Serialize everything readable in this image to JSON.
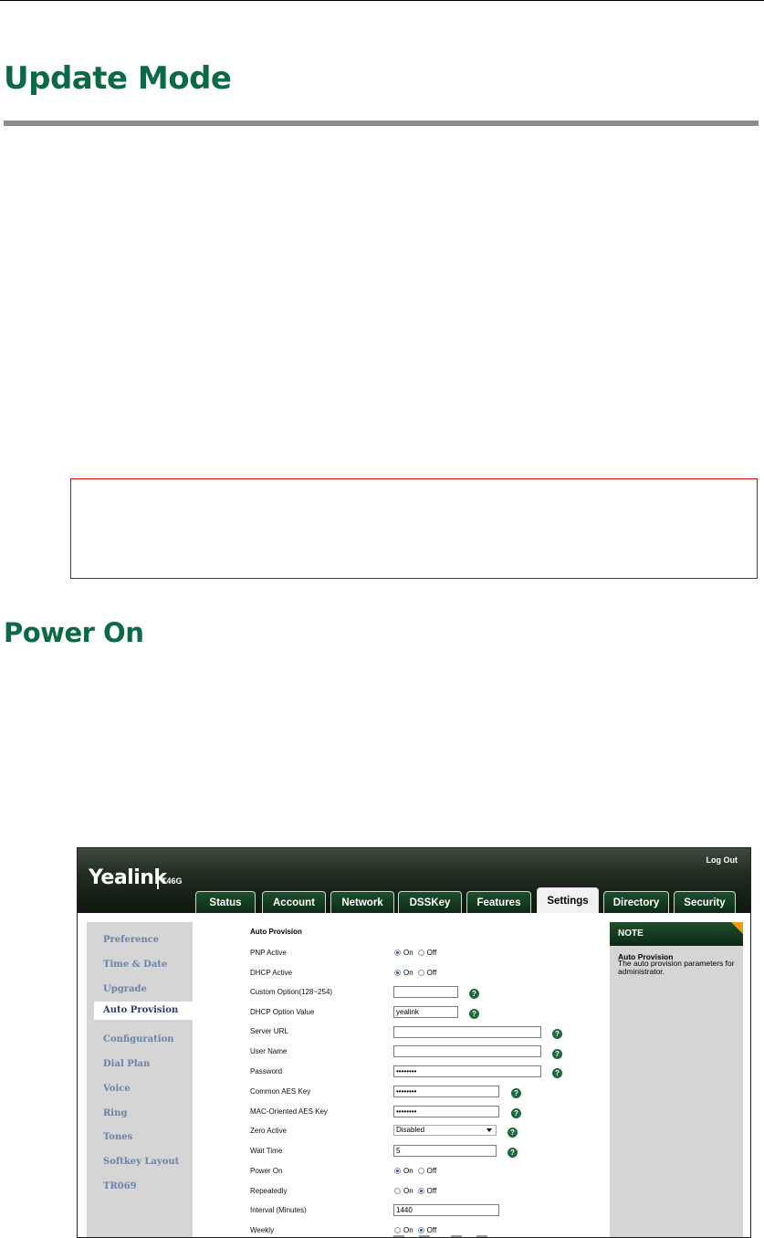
{
  "doc": {
    "title": "Update Mode",
    "section": "Power On"
  },
  "ui": {
    "logo": "Yealink",
    "model": "T46G",
    "logout": "Log Out",
    "tabs": [
      "Status",
      "Account",
      "Network",
      "DSSKey",
      "Features",
      "Settings",
      "Directory",
      "Security"
    ],
    "active_tab": "Settings",
    "nav": [
      "Preference",
      "Time & Date",
      "Upgrade",
      "Auto Provision",
      "Configuration",
      "Dial Plan",
      "Voice",
      "Ring",
      "Tones",
      "Softkey Layout",
      "TR069"
    ],
    "active_nav": "Auto Provision",
    "form": {
      "title": "Auto Provision",
      "pnp_label": "PNP Active",
      "dhcp_label": "DHCP Active",
      "custom_option_label": "Custom Option(128~254)",
      "custom_option_value": "",
      "dhcp_option_label": "DHCP Option Value",
      "dhcp_option_value": "yealink",
      "server_url_label": "Server URL",
      "server_url_value": "",
      "user_name_label": "User Name",
      "user_name_value": "",
      "password_label": "Password",
      "password_value": "••••••••",
      "common_aes_label": "Common AES Key",
      "common_aes_value": "••••••••",
      "mac_aes_label": "MAC-Oriented AES Key",
      "mac_aes_value": "••••••••",
      "zero_active_label": "Zero Active",
      "zero_active_value": "Disabled",
      "wait_time_label": "Wait Time",
      "wait_time_value": "5",
      "power_on_label": "Power On",
      "repeatedly_label": "Repeatedly",
      "interval_label": "Interval (Minutes)",
      "interval_value": "1440",
      "weekly_label": "Weekly",
      "on": "On",
      "off": "Off",
      "help": "?"
    },
    "note": {
      "header": "NOTE",
      "title": "Auto Provision",
      "text": "The auto provision parameters for administrator."
    }
  }
}
